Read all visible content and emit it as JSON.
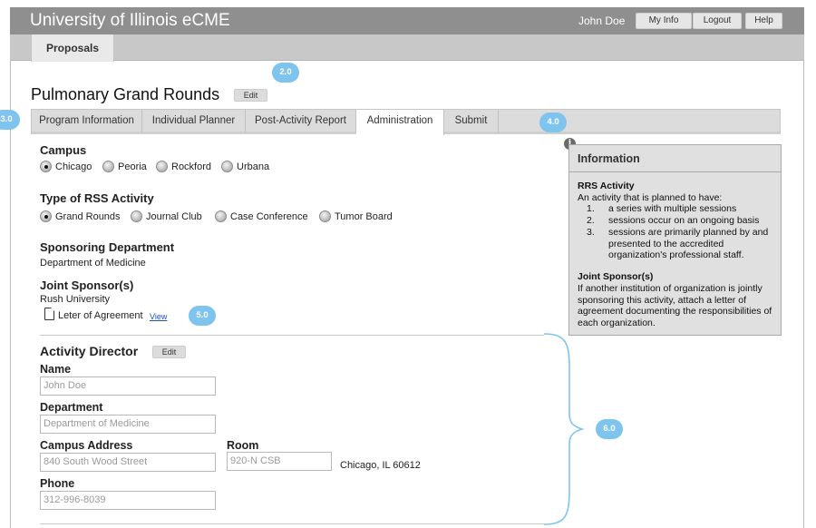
{
  "header": {
    "app_title": "University of Illinois eCME",
    "user_name": "John Doe",
    "buttons": {
      "my_info": "My Info",
      "logout": "Logout",
      "help": "Help"
    }
  },
  "nav": {
    "proposals": "Proposals"
  },
  "page": {
    "title": "Pulmonary Grand Rounds",
    "edit_label": "Edit"
  },
  "tabs": [
    {
      "label": "Program Information"
    },
    {
      "label": "Individual Planner"
    },
    {
      "label": "Post-Activity Report"
    },
    {
      "label": "Administration"
    },
    {
      "label": "Submit"
    }
  ],
  "active_tab": "Administration",
  "campus": {
    "label": "Campus",
    "options": [
      "Chicago",
      "Peoria",
      "Rockford",
      "Urbana"
    ],
    "selected": "Chicago"
  },
  "rss_type": {
    "label": "Type of RSS Activity",
    "options": [
      "Grand Rounds",
      "Journal Club",
      "Case Conference",
      "Tumor Board"
    ],
    "selected": "Grand Rounds"
  },
  "sponsoring": {
    "label": "Sponsoring Department",
    "value": "Department of Medicine"
  },
  "joint_sponsor": {
    "label": "Joint Sponsor(s)",
    "value": "Rush University",
    "document": "Leter of Agreement",
    "view_link": "View"
  },
  "activity_director": {
    "title": "Activity Director",
    "edit_label": "Edit",
    "name_label": "Name",
    "name_value": "John Doe",
    "department_label": "Department",
    "department_value": "Department of Medicine",
    "address_label": "Campus Address",
    "address_value": "840 South Wood Street",
    "room_label": "Room",
    "room_value": "920-N CSB",
    "city": "Chicago, IL 60612",
    "phone_label": "Phone",
    "phone_value": "312-996-8039"
  },
  "info": {
    "title": "Information",
    "rrs_title": "RRS Activity",
    "rrs_intro": "An activity that is planned to have:",
    "rrs_items": [
      "a series with multiple sessions",
      "sessions occur on an ongoing basis",
      "sessions are primarily planned by and presented to the accredited organization's professional staff."
    ],
    "rrs_numbers": [
      "1.",
      "2.",
      "3."
    ],
    "joint_title": "Joint Sponsor(s)",
    "joint_text": "If another institution of organization is jointly sponsoring this activity, attach a letter of agreement documenting the responsibilities of each organization."
  },
  "markers": [
    "2.0",
    "3.0",
    "4.0",
    "5.0",
    "6.0"
  ],
  "colors": {
    "topbar": "#8f8f8f",
    "navbar": "#c8c8c8",
    "marker": "#7fc4ef",
    "link": "#1a4fd0",
    "info_panel": "#e0e0e0"
  }
}
